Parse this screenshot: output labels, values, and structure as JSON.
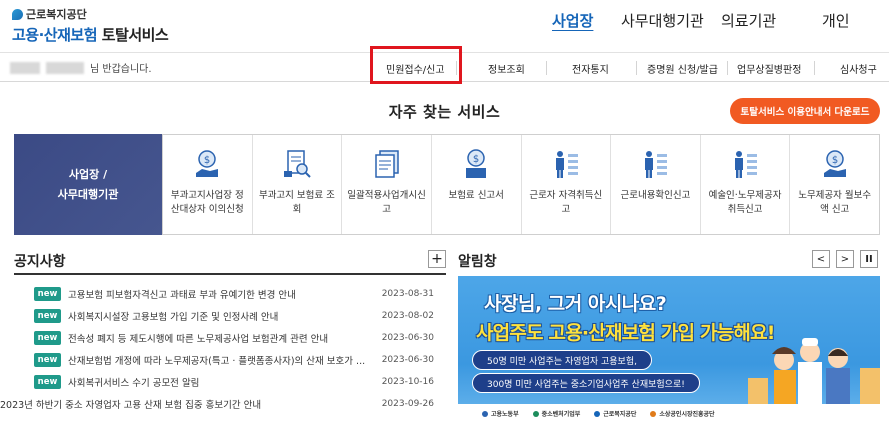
{
  "logo": {
    "org": "근로복지공단",
    "title_blue": "고용·산재보험",
    "title_dark": "토탈서비스"
  },
  "topnav": [
    "사업장",
    "사무대행기관",
    "의료기관",
    "개인"
  ],
  "greeting": "님 반갑습니다.",
  "subnav": [
    "민원접수/신고",
    "정보조회",
    "전자통지",
    "증명원 신청/발급",
    "업무상질병판정",
    "심사청구"
  ],
  "faq": {
    "title": "자주 찾는 서비스",
    "download": "토탈서비스 이용안내서 다운로드",
    "left_l1": "사업장 /",
    "left_l2": "사무대행기관"
  },
  "services": [
    {
      "label": "부과고지사업장 정산대상자 이의신청",
      "icon": "coin-hand-icon"
    },
    {
      "label": "부과고지 보험료 조회",
      "icon": "document-search-icon"
    },
    {
      "label": "일괄적용사업개시신고",
      "icon": "document-stack-icon"
    },
    {
      "label": "보험료 신고서",
      "icon": "coin-monitor-icon"
    },
    {
      "label": "근로자 자격취득신고",
      "icon": "worker-list-icon"
    },
    {
      "label": "근로내용확인신고",
      "icon": "worker-list-icon"
    },
    {
      "label": "예술인·노무제공자 취득신고",
      "icon": "worker-list-icon"
    },
    {
      "label": "노무제공자 월보수액 신고",
      "icon": "coin-hand-icon"
    }
  ],
  "notice": {
    "title": "공지사항",
    "plus": "+",
    "items": [
      {
        "new": "new",
        "text": "고용보험 피보험자격신고 과태료 부과 유예기한 변경 안내",
        "date": "2023-08-31"
      },
      {
        "new": "new",
        "text": "사회복지시설장 고용보험 가입 기준 및 인정사례 안내",
        "date": "2023-08-02"
      },
      {
        "new": "new",
        "text": "전속성 폐지 등 제도시행에 따른 노무제공사업 보험관계 관련 안내",
        "date": "2023-06-30"
      },
      {
        "new": "new",
        "text": "산재보험법 개정에 따라 노무제공자(특고 · 플랫폼종사자)의 산재 보호가 ...",
        "date": "2023-06-30"
      },
      {
        "new": "new",
        "text": "사회복귀서비스 수기 공모전 알림",
        "date": "2023-10-16"
      },
      {
        "new": "",
        "text": "2023년 하반기 중소 자영업자 고용 산재 보험 집중 홍보기간 안내",
        "date": "2023-09-26"
      }
    ]
  },
  "alert": {
    "title": "알림창",
    "prev": "<",
    "next": ">",
    "pause": "II",
    "banner_l1": "사장님, 그거 아시나요?",
    "banner_l2": "사업주도 고용·산재보험 가입 가능해요!",
    "pill1": "50명 미만 사업주는 자영업자 고용보험,",
    "pill2": "300명 미만 사업주는 중소기업사업주 산재보험으로!",
    "orgs": [
      "고용노동부",
      "중소벤처기업부",
      "근로복지공단",
      "소상공인시장진흥공단"
    ]
  },
  "colors": {
    "brand_blue": "#1565b8",
    "accent_orange": "#f15a22",
    "new_badge": "#1f9a8a",
    "highlight": "#e0161e",
    "service_left": "#3b4a85"
  }
}
